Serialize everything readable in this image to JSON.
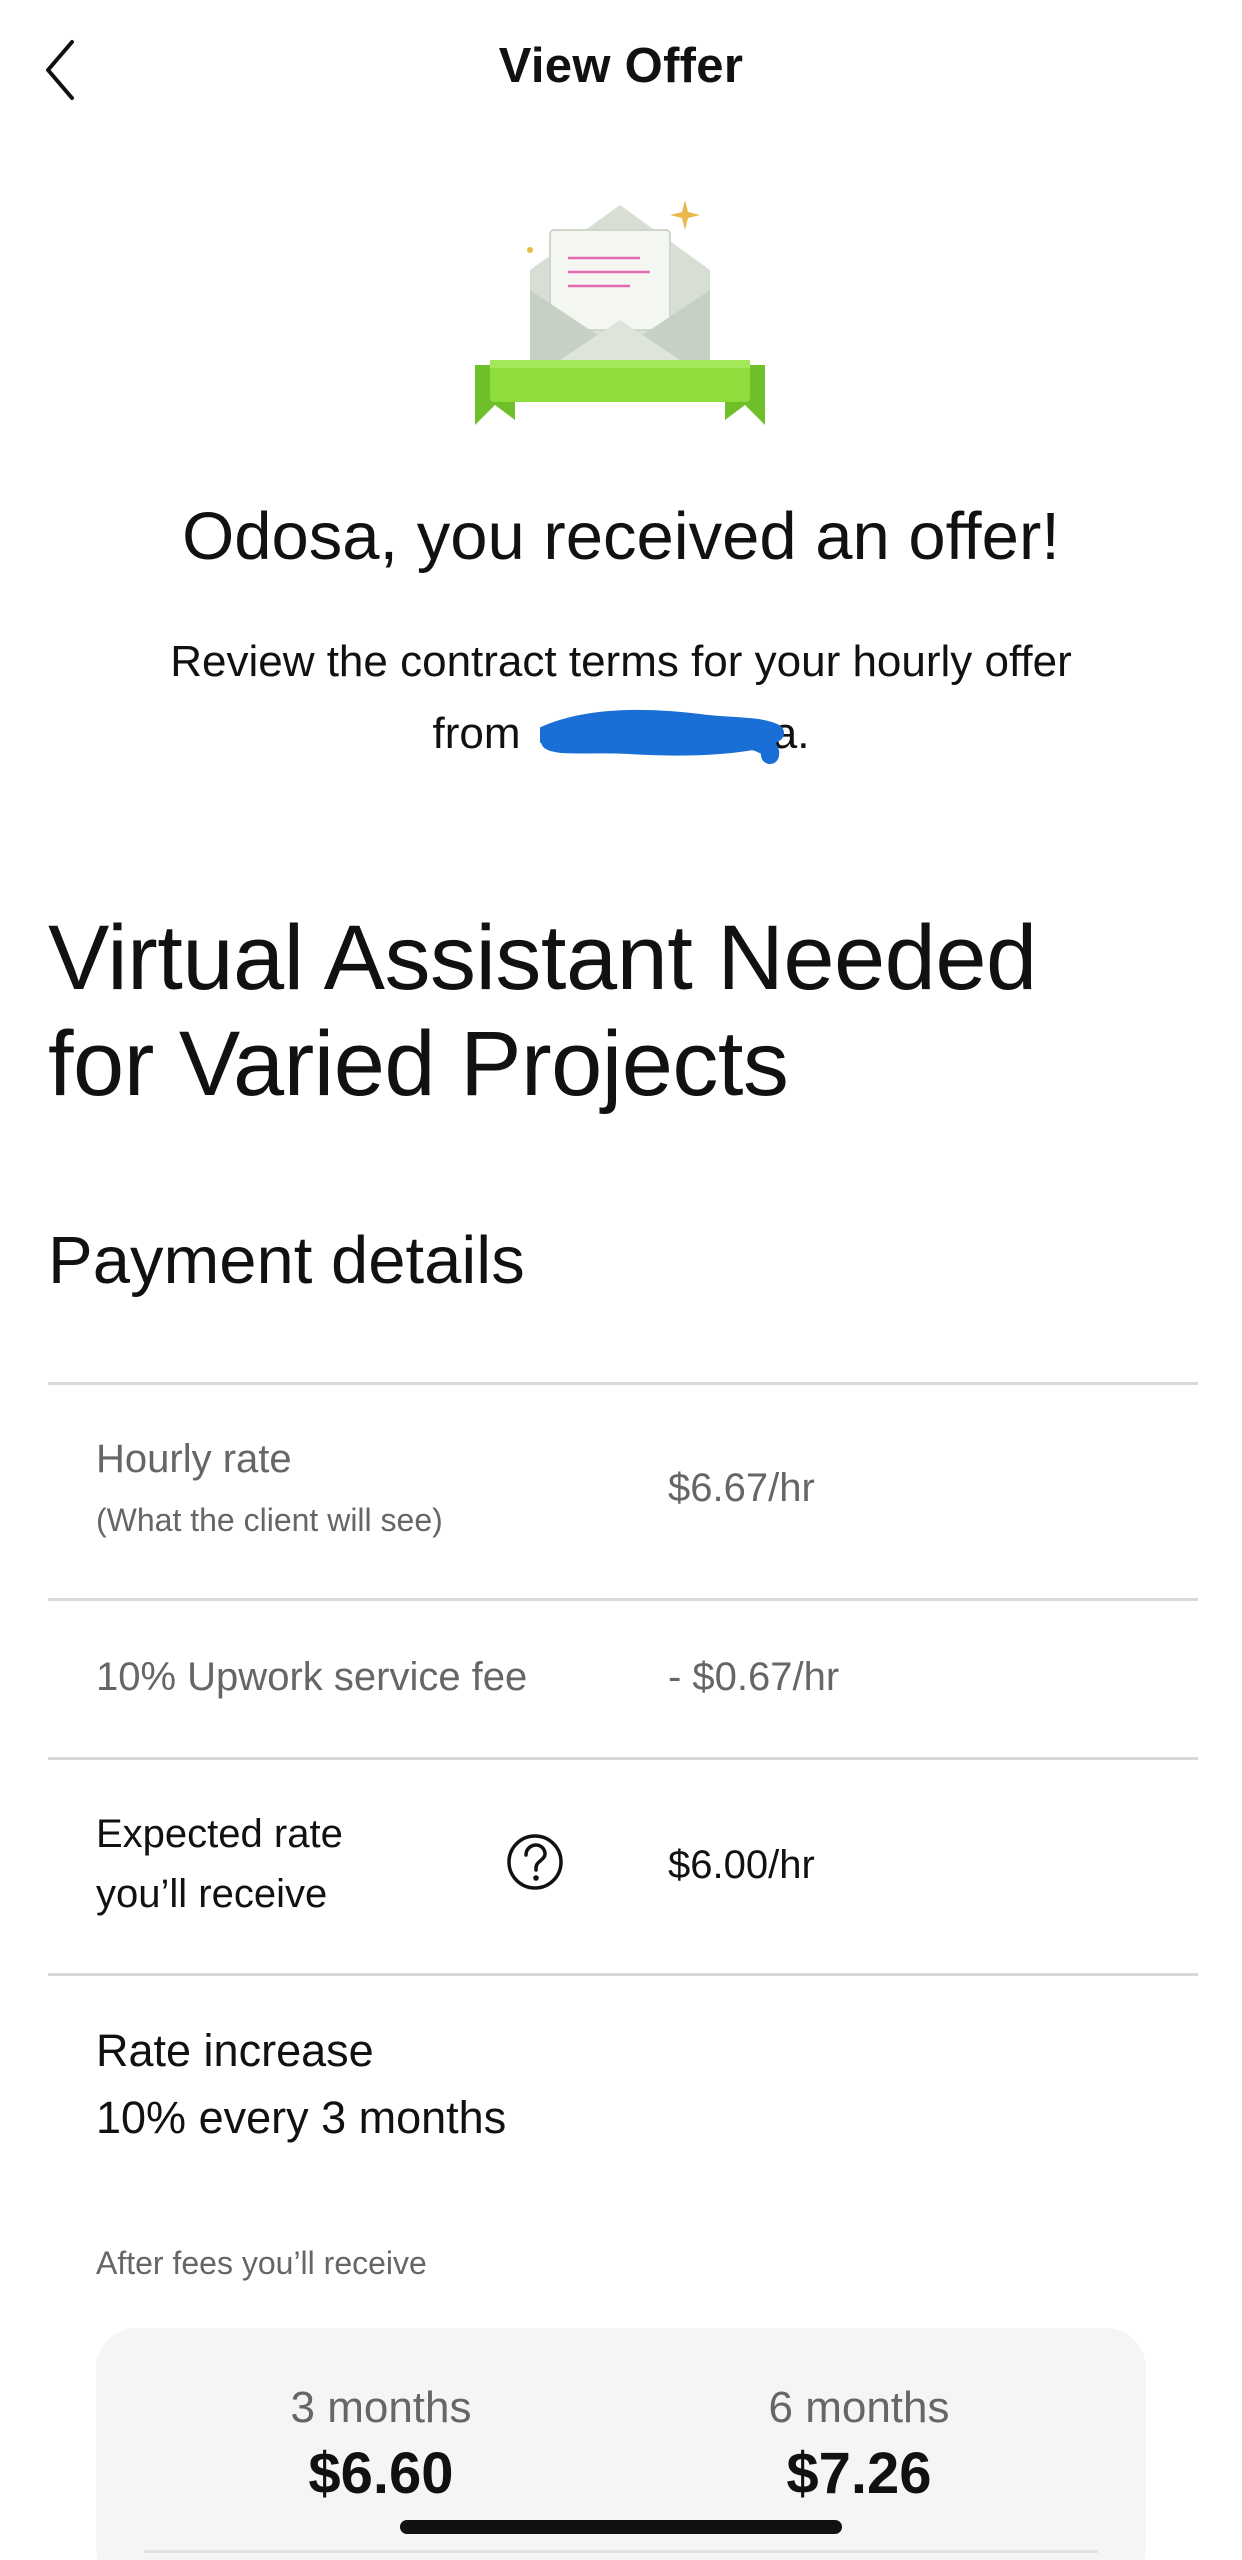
{
  "header": {
    "title": "View Offer",
    "back_icon": "chevron-left-icon"
  },
  "illustration": {
    "icon": "envelope-with-letter-and-ribbon-icon"
  },
  "offer": {
    "headline": "Odosa, you received an offer!",
    "description_line1": "Review the contract terms for your hourly offer",
    "description_line2_prefix": "from ",
    "description_line2_suffix": "a."
  },
  "job": {
    "title_line1": "Virtual Assistant Needed",
    "title_line2": "for Varied Projects"
  },
  "payment": {
    "section_title": "Payment details",
    "rows": [
      {
        "label": "Hourly rate",
        "sublabel": "(What the client will see)",
        "value": "$6.67/hr"
      },
      {
        "label": "10% Upwork service fee",
        "value": "- $0.67/hr"
      },
      {
        "label_line1": "Expected rate",
        "label_line2": "you’ll receive",
        "value": "$6.00/hr",
        "help_icon": "question-circle-icon"
      }
    ],
    "rate_increase": {
      "title": "Rate increase",
      "description": "10% every 3 months"
    },
    "after_fees_label": "After fees you’ll receive",
    "projections": [
      {
        "period": "3 months",
        "amount": "$6.60"
      },
      {
        "period": "6 months",
        "amount": "$7.26"
      }
    ]
  },
  "colors": {
    "accent_green": "#8fdd3c",
    "redaction_blue": "#1a6fd6"
  }
}
